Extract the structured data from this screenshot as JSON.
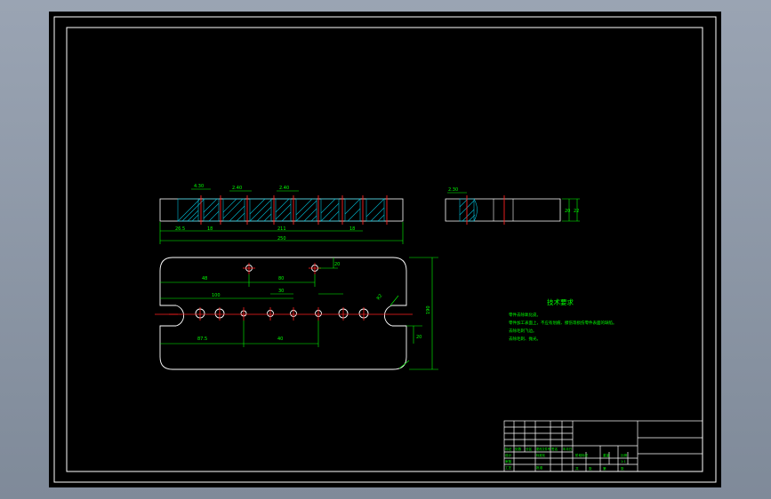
{
  "colors": {
    "background": "#000000",
    "outline": "#ffffff",
    "dimension": "#00ff00",
    "centerline": "#ff0000",
    "hatch": "#00bcd4",
    "viewport": "#8c97a6"
  },
  "dimensions": {
    "top_view": [
      "4.30",
      "2.40",
      "2.40",
      "26.5",
      "18",
      "211",
      "18",
      "250"
    ],
    "side_view": [
      "2.30",
      "20",
      "22"
    ],
    "plan_view": [
      "48",
      "20",
      "80",
      "100",
      "30",
      "R2",
      "87.5",
      "40",
      "20",
      "190"
    ]
  },
  "technical_requirements": {
    "title": "技术要求",
    "items": [
      "零件去除氧化皮。",
      "零件加工表面上，不应有划痕、擦伤等损伤零件表面的缺陷。",
      "去除毛刺飞边。",
      "去除毛刺、抛光。"
    ]
  },
  "title_block": {
    "labels": [
      "标记",
      "处数",
      "分区",
      "更改文件号",
      "签名",
      "年月日",
      "设计",
      "标准化",
      "阶段标记",
      "重量",
      "比例",
      "审核",
      "工艺",
      "批准",
      "共",
      "张",
      "第",
      "张"
    ],
    "scale": "1:1"
  }
}
